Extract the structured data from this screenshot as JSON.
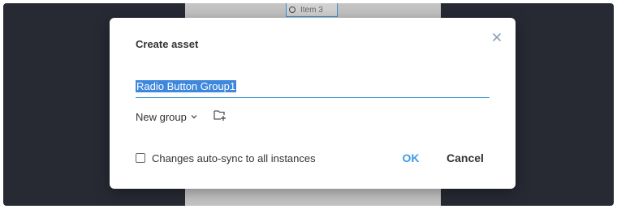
{
  "canvas": {
    "item_label": "Item 3"
  },
  "dialog": {
    "title": "Create asset",
    "close_icon": "close-icon",
    "name_value": "Radio Button Group1",
    "group_label": "New group",
    "group_chevron_icon": "chevron-down-icon",
    "new_folder_icon": "folder-plus-icon",
    "checkbox_label": "Changes auto-sync to all instances",
    "checkbox_checked": false,
    "ok_label": "OK",
    "cancel_label": "Cancel"
  },
  "colors": {
    "accent": "#3d9be9",
    "selection": "#3d87dd",
    "overlay": "#272a33"
  }
}
